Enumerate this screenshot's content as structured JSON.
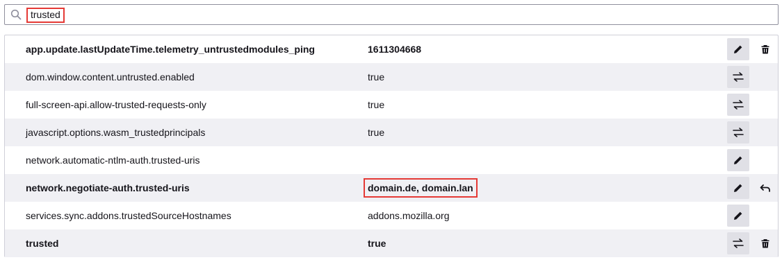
{
  "search": {
    "value": "trusted"
  },
  "prefs": [
    {
      "name": "app.update.lastUpdateTime.telemetry_untrustedmodules_ping",
      "value": "1611304668",
      "modified": true,
      "action": "edit",
      "secondary": "delete"
    },
    {
      "name": "dom.window.content.untrusted.enabled",
      "value": "true",
      "modified": false,
      "action": "toggle",
      "secondary": ""
    },
    {
      "name": "full-screen-api.allow-trusted-requests-only",
      "value": "true",
      "modified": false,
      "action": "toggle",
      "secondary": ""
    },
    {
      "name": "javascript.options.wasm_trustedprincipals",
      "value": "true",
      "modified": false,
      "action": "toggle",
      "secondary": ""
    },
    {
      "name": "network.automatic-ntlm-auth.trusted-uris",
      "value": "",
      "modified": false,
      "action": "edit",
      "secondary": ""
    },
    {
      "name": "network.negotiate-auth.trusted-uris",
      "value": "domain.de, domain.lan",
      "modified": true,
      "action": "edit",
      "secondary": "reset"
    },
    {
      "name": "services.sync.addons.trustedSourceHostnames",
      "value": "addons.mozilla.org",
      "modified": false,
      "action": "edit",
      "secondary": ""
    },
    {
      "name": "trusted",
      "value": "true",
      "modified": true,
      "action": "toggle",
      "secondary": "delete"
    }
  ]
}
